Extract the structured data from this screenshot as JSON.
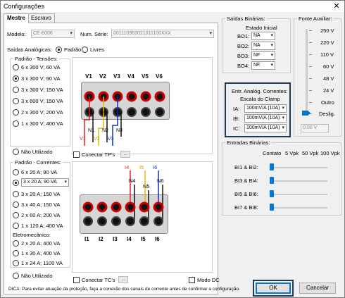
{
  "window": {
    "title": "Configurações",
    "close_glyph": "✕"
  },
  "tabs": [
    {
      "label": "Mestre"
    },
    {
      "label": "Escravo"
    }
  ],
  "modelo": {
    "label": "Modelo:",
    "value": "CE-6006"
  },
  "num_serie": {
    "label": "Num. Série:",
    "value": "001110963021011100XXX"
  },
  "saidas_analogicas": {
    "label": "Saídas Analógicas:",
    "padrao": "Padrão",
    "livres": "Livres"
  },
  "tensoes": {
    "title": "Padrão - Tensões:",
    "options": [
      "6 x 300 V; 60 VA",
      "3 x 300 V; 90 VA",
      "3 x 300 V; 150 VA",
      "3 x 600 V; 150 VA",
      "2 x 300 V; 200 VA",
      "1 x 300 V; 400 VA"
    ],
    "nao_utilizado": "Não Utilizado",
    "conectar": "Conectar TP's",
    "ellipsis": "...",
    "terminals": [
      "V1",
      "V2",
      "V3",
      "V4",
      "V5",
      "V6"
    ],
    "wires": [
      "V1",
      "N1",
      "V2",
      "N2",
      "V3",
      "N3"
    ]
  },
  "correntes": {
    "title": "Padrão - Correntes:",
    "options": [
      "6 x 20 A; 90 VA",
      "3 x 20 A; 90 VA",
      "3 x 20 A; 150 VA",
      "3 x 40 A; 150 VA",
      "2 x 60 A; 200 VA",
      "1 x 120 A; 400 VA"
    ],
    "selected_combo": "3 x 20 A; 90 VA",
    "eletromecanico": "Eletromecânico:",
    "eletro_options": [
      "2 x 20 A; 400 VA",
      "1 x 30 A; 400 VA",
      "1 x 24 A; 1100 VA"
    ],
    "nao_utilizado": "Não Utilizado",
    "conectar": "Conectar TC's",
    "ellipsis": "...",
    "modo_dc": "Modo DC",
    "terminals": [
      "I1",
      "I2",
      "I3",
      "I4",
      "I5",
      "I6"
    ],
    "wires_top": [
      "I4",
      "I5",
      "I6"
    ],
    "wires_n": [
      "N4",
      "N5",
      "N6"
    ]
  },
  "dica": "DICA: Para evitar atuação da proteção, faça a conexão dos canais de corrente antes de confirmar a configuração.",
  "saidas_binarias": {
    "title": "Saídas Binárias:",
    "estado": "Estado Inicial",
    "rows": [
      {
        "label": "BO1:",
        "value": "NA"
      },
      {
        "label": "BO2:",
        "value": "NA"
      },
      {
        "label": "BO3:",
        "value": "NF"
      },
      {
        "label": "BO4:",
        "value": "NF"
      }
    ]
  },
  "fonte_auxiliar": {
    "title": "Fonte Auxiliar:",
    "levels": [
      "250 V",
      "220 V",
      "110 V",
      "60 V",
      "48 V",
      "24 V",
      "Outro",
      "Deslig."
    ],
    "readout": "0.00 V"
  },
  "clamp": {
    "title": "Entr. Analóg. Correntes:",
    "escala": "Escala do Clamp",
    "rows": [
      {
        "label": "IA:",
        "value": "100mV/A (10A)"
      },
      {
        "label": "IB:",
        "value": "100mV/A (10A)"
      },
      {
        "label": "IC:",
        "value": "100mV/A (10A)"
      }
    ]
  },
  "entradas_binarias": {
    "title": "Entradas Binárias:",
    "headers": [
      "Contato",
      "5 Vpk",
      "50 Vpk",
      "100 Vpk"
    ],
    "rows": [
      "BI1 & BI2:",
      "BI3 & BI4:",
      "BI5 & BI6:",
      "BI7 & BI8:"
    ]
  },
  "buttons": {
    "ok": "OK",
    "cancel": "Cancelar"
  },
  "colors": {
    "accent": "#0078d7",
    "wire_red": "#e02020",
    "wire_yellow": "#e8b800",
    "wire_blue": "#1030c0",
    "wire_black": "#111111",
    "frame_highlight": "#1f3a58"
  }
}
